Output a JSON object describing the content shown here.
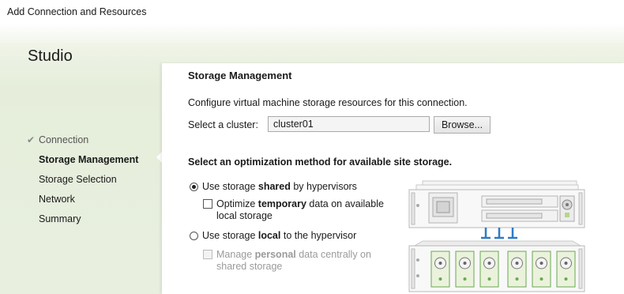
{
  "window": {
    "title": "Add Connection and Resources"
  },
  "sidebar": {
    "title": "Studio",
    "steps": [
      {
        "label": "Connection",
        "state": "done"
      },
      {
        "label": "Storage Management",
        "state": "current"
      },
      {
        "label": "Storage Selection",
        "state": "pending"
      },
      {
        "label": "Network",
        "state": "pending"
      },
      {
        "label": "Summary",
        "state": "pending"
      }
    ]
  },
  "main": {
    "title": "Storage Management",
    "description": "Configure virtual machine storage resources for this connection.",
    "cluster": {
      "label": "Select a cluster:",
      "value": "cluster01",
      "browse_label": "Browse..."
    },
    "optimization_heading": "Select an optimization method for available site storage.",
    "options": {
      "shared": {
        "pre": "Use storage ",
        "bold": "shared",
        "post": " by hypervisors",
        "selected": true
      },
      "temporary": {
        "pre": "Optimize ",
        "bold": "temporary",
        "post": " data on available",
        "line2": "local storage",
        "checked": false
      },
      "local": {
        "pre": "Use storage ",
        "bold": "local",
        "post": " to the hypervisor",
        "selected": false
      },
      "personal": {
        "pre": "Manage ",
        "bold": "personal",
        "post": " data centrally on",
        "line2": "shared storage",
        "checked": false,
        "disabled": true
      }
    }
  },
  "colors": {
    "accent_blue": "#2e7bc4",
    "disk_green": "#6aa84f",
    "banner_green": "#e6eedb"
  }
}
